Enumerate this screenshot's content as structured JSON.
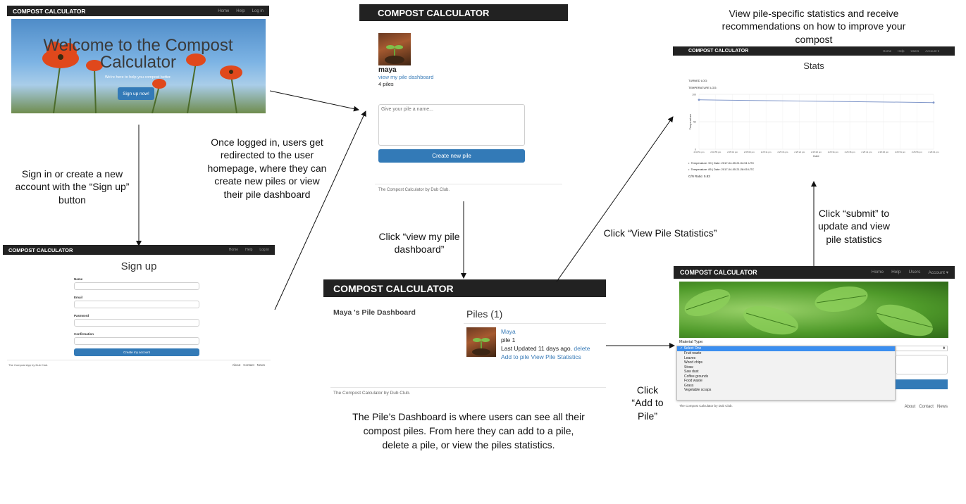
{
  "brand": "COMPOST CALCULATOR",
  "screen_home": {
    "nav_links": [
      "Home",
      "Help",
      "Log in"
    ],
    "hero_title": "Welcome to the Compost Calculator",
    "hero_subtitle": "We're here to help you compost better.",
    "signup_button": "Sign up now!"
  },
  "screen_signup": {
    "nav_links": [
      "Home",
      "Help",
      "Log in"
    ],
    "title": "Sign up",
    "fields": [
      "Name",
      "Email",
      "Password",
      "Confirmation"
    ],
    "submit": "Create my account",
    "footer_left": "The Compost App by Dub Club.",
    "footer_links": [
      "About",
      "Contact",
      "News"
    ]
  },
  "screen_user": {
    "username": "maya",
    "dashboard_link": "view my pile dashboard",
    "pile_count": "4 piles",
    "name_placeholder": "Give your pile a name...",
    "create_button": "Create new pile",
    "footer": "The Compost Calculator by Dub Club."
  },
  "screen_dashboard": {
    "heading": "Maya 's Pile Dashboard",
    "piles_title": "Piles (1)",
    "pile_name": "Maya",
    "pile_label": "pile 1",
    "updated_text": "Last Updated 11 days ago.",
    "delete_link": "delete",
    "add_link": "Add to pile",
    "stats_link": "View Pile Statistics",
    "footer": "The Compost Calculator by Dub Club."
  },
  "screen_stats": {
    "nav_links": [
      "Home",
      "Help",
      "Users",
      "Account ▾"
    ],
    "title": "Stats",
    "turned_log": "TURNED LOG:",
    "temperature_log": "TEMPERATURE LOG:",
    "y_axis_label": "Temperature",
    "x_axis_label": "Date",
    "entries": [
      "Temperature: 90 | Date: 2017-04-05 21:04:51 UTC",
      "Temperature: 85 | Date: 2017-04-05 21:28:05 UTC"
    ],
    "cn_ratio": "C/N Ratio: 5.83"
  },
  "screen_add": {
    "nav_links": [
      "Home",
      "Help",
      "Users",
      "Account ▾"
    ],
    "material_label": "Material Type:",
    "selected_option": "✓ Select One",
    "options": [
      "Fruit waste",
      "Leaves",
      "Wood chips",
      "Straw",
      "Saw dust",
      "Coffee grounds",
      "Food waste",
      "Grass",
      "Vegetable scraps"
    ],
    "footer_left": "The Compost Calculator by Dub Club.",
    "footer_links": [
      "About",
      "Contact",
      "News"
    ]
  },
  "captions": {
    "signin": "Sign in or create a new account with the “Sign up” button",
    "loggedin": "Once logged in, users  get redirected to the user homepage, where they can create new piles or view their pile dashboard",
    "viewdash": "Click “view my pile dashboard”",
    "viewstats": "Click “View Pile Statistics”",
    "statsdesc": "View pile-specific statistics and receive recommendations on how to improve your compost",
    "submit": "Click “submit” to update and view pile statistics",
    "addpile": "Click “Add to Pile”",
    "dashdesc": "The Pile’s Dashboard is where users can see all their compost piles. From here they can add to a pile, delete a pile, or view the piles statistics."
  },
  "chart_data": {
    "type": "line",
    "title": "",
    "xlabel": "Date",
    "ylabel": "Temperature",
    "ylim": [
      0,
      100
    ],
    "y_ticks": [
      0,
      50,
      100
    ],
    "x_tick_labels": [
      "2:04:51 pm",
      "2:04:55 pm",
      "2:05:01 pm",
      "2:05:06 pm",
      "2:25:11 pm",
      "2:25:16 pm",
      "2:25:21 pm",
      "2:25:26 pm",
      "2:25:31 pm",
      "2:25:36 pm",
      "2:25:41 pm",
      "2:25:46 pm",
      "2:25:51 pm",
      "2:25:56 pm",
      "2:26:01 pm"
    ],
    "series": [
      {
        "color": "#7f96c9",
        "x": [
          "2:04:51 pm",
          "2:26:01 pm"
        ],
        "values": [
          90,
          85
        ]
      }
    ],
    "grid": true
  }
}
